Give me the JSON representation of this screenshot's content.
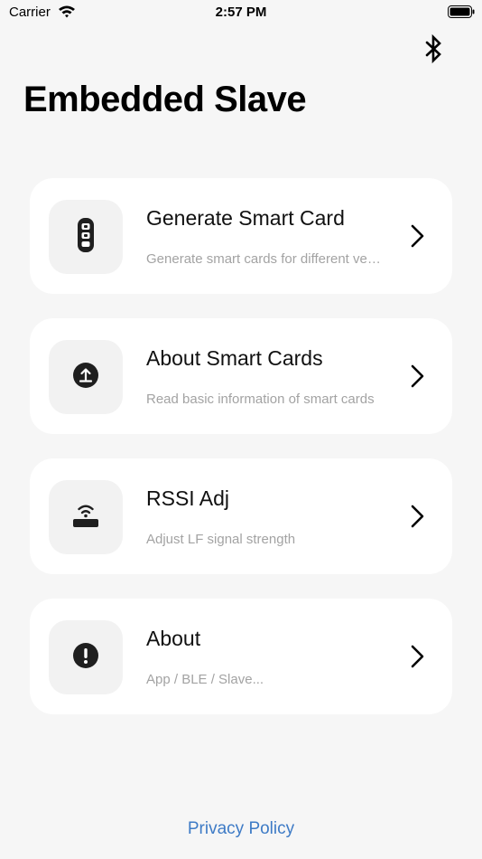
{
  "status_bar": {
    "carrier": "Carrier",
    "time": "2:57 PM"
  },
  "header": {
    "title": "Embedded Slave",
    "bluetooth_icon": "bluetooth-icon"
  },
  "menu": [
    {
      "title": "Generate Smart Card",
      "subtitle": "Generate smart cards for different vehicles",
      "icon": "key-fob-icon"
    },
    {
      "title": "About Smart Cards",
      "subtitle": "Read basic information of smart cards",
      "icon": "upload-circle-icon"
    },
    {
      "title": "RSSI Adj",
      "subtitle": "Adjust LF signal strength",
      "icon": "signal-icon"
    },
    {
      "title": "About",
      "subtitle": "App / BLE / Slave...",
      "icon": "exclamation-circle-icon"
    }
  ],
  "footer": {
    "privacy_label": "Privacy Policy"
  },
  "colors": {
    "background": "#f6f6f6",
    "card": "#ffffff",
    "link": "#3e7bc6",
    "subtitle": "#a3a3a3"
  }
}
